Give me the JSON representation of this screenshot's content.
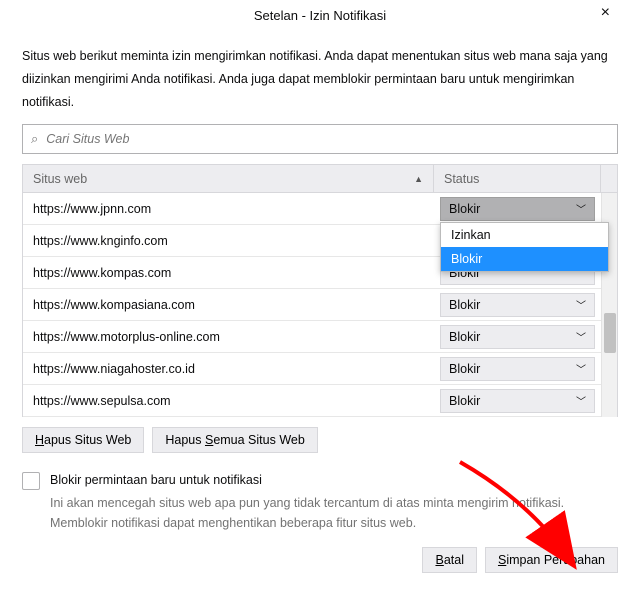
{
  "title": "Setelan - Izin Notifikasi",
  "description": "Situs web berikut meminta izin mengirimkan notifikasi. Anda dapat menentukan situs web mana saja yang diizinkan mengirimi Anda notifikasi. Anda juga dapat memblokir permintaan baru untuk mengirimkan notifikasi.",
  "search": {
    "placeholder": "Cari Situs Web"
  },
  "columns": {
    "site": "Situs web",
    "status": "Status"
  },
  "options": {
    "allow": "Izinkan",
    "block": "Blokir"
  },
  "rows": [
    {
      "url": "https://www.jpnn.com",
      "status": "Blokir",
      "open": true
    },
    {
      "url": "https://www.knginfo.com",
      "status": "Blokir",
      "open": false
    },
    {
      "url": "https://www.kompas.com",
      "status": "Blokir",
      "open": false
    },
    {
      "url": "https://www.kompasiana.com",
      "status": "Blokir",
      "open": false
    },
    {
      "url": "https://www.motorplus-online.com",
      "status": "Blokir",
      "open": false
    },
    {
      "url": "https://www.niagahoster.co.id",
      "status": "Blokir",
      "open": false
    },
    {
      "url": "https://www.sepulsa.com",
      "status": "Blokir",
      "open": false
    }
  ],
  "buttons": {
    "remove": "Hapus Situs Web",
    "removeAll": "Hapus Semua Situs Web",
    "cancel": "Batal",
    "save": "Simpan Perubahan"
  },
  "checkbox": {
    "label": "Blokir permintaan baru untuk notifikasi",
    "hint": "Ini akan mencegah situs web apa pun yang tidak tercantum di atas minta mengirim notifikasi. Memblokir notifikasi dapat menghentikan beberapa fitur situs web."
  }
}
